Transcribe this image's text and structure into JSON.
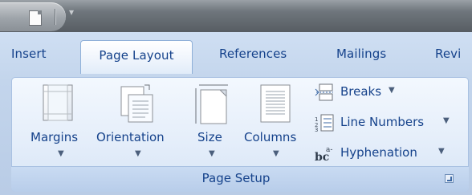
{
  "tabs": [
    "Insert",
    "Page Layout",
    "References",
    "Mailings",
    "Revi"
  ],
  "active_tab": "Page Layout",
  "group": {
    "label": "Page Setup"
  },
  "buttons": {
    "margins": "Margins",
    "orientation": "Orientation",
    "size": "Size",
    "columns": "Columns"
  },
  "small_buttons": {
    "breaks": "Breaks",
    "line_numbers": "Line Numbers",
    "hyphenation": "Hyphenation"
  },
  "icons": {
    "qat_document": "document-icon",
    "qat_customize": "dropdown-arrow-icon",
    "margins": "margins-icon",
    "orientation": "orientation-icon",
    "size": "page-size-icon",
    "columns": "columns-icon",
    "breaks": "breaks-icon",
    "line_numbers": "line-numbers-icon",
    "hyphenation": "hyphenation-icon",
    "dialog_launcher": "dialog-launcher-icon"
  },
  "colors": {
    "tab_text": "#15428b",
    "ribbon_bg": "#c3d5ec",
    "panel_bg": "#e5eefa"
  }
}
